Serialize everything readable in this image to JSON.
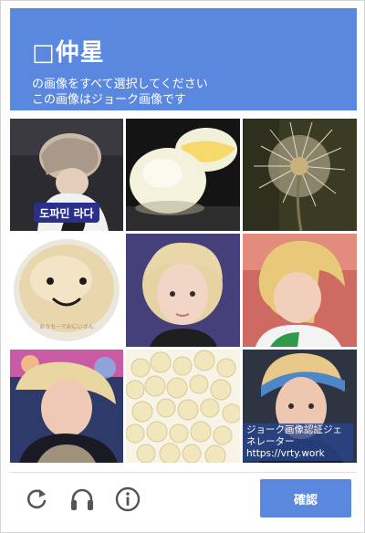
{
  "header": {
    "title": "□仲星",
    "line1": "の画像をすべて選択してください",
    "line2": "この画像はジョーク画像です"
  },
  "tiles": [
    {
      "name": "tile-1",
      "caption": "도파민 라다"
    },
    {
      "name": "tile-2"
    },
    {
      "name": "tile-3"
    },
    {
      "name": "tile-4",
      "caption": "おうちーでおにいさん"
    },
    {
      "name": "tile-5"
    },
    {
      "name": "tile-6"
    },
    {
      "name": "tile-7"
    },
    {
      "name": "tile-8"
    },
    {
      "name": "tile-9"
    }
  ],
  "watermark": {
    "line1": "ジョーク画像認証ジェネレーター",
    "line2": "https://vrty.work"
  },
  "footer": {
    "reload_icon": "reload-icon",
    "audio_icon": "headphones-icon",
    "info_icon": "info-icon",
    "verify_label": "確認"
  },
  "colors": {
    "accent": "#5b88df"
  }
}
